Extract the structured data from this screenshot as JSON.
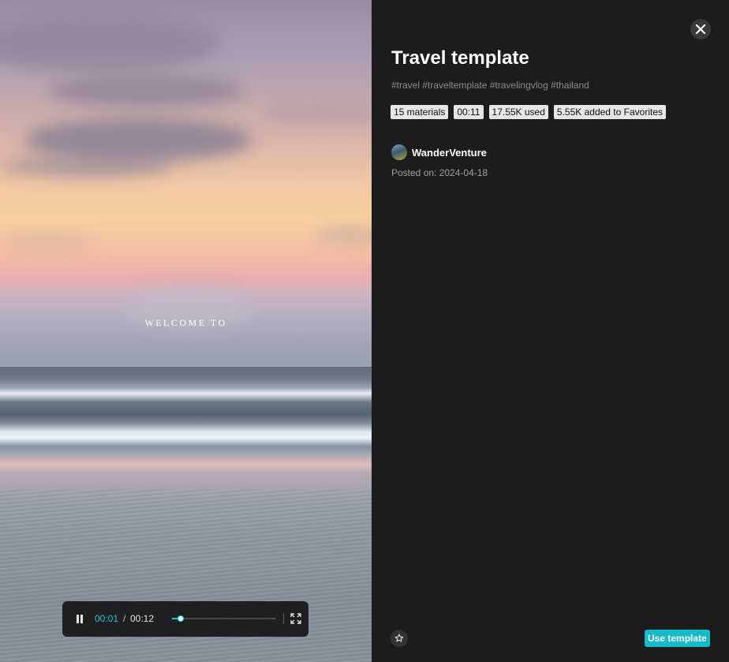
{
  "preview": {
    "overlay_text": "WELCOME TO",
    "player": {
      "current_time": "00:01",
      "separator": "/",
      "total_time": "00:12",
      "progress": 0.08
    }
  },
  "details": {
    "title": "Travel template",
    "tags": "#travel #traveltemplate #travelingvlog #thailand",
    "badges": [
      "15 materials",
      "00:11",
      "17.55K used",
      "5.55K added to Favorites"
    ],
    "author": "WanderVenture",
    "posted": "Posted on: 2024-04-18",
    "use_button": "Use template"
  },
  "icons": {
    "close": "close-icon",
    "pause": "pause-icon",
    "fullscreen": "fullscreen-icon",
    "favorite": "star-icon"
  },
  "colors": {
    "accent": "#14bccb",
    "panel_background": "#1c1c1c"
  }
}
